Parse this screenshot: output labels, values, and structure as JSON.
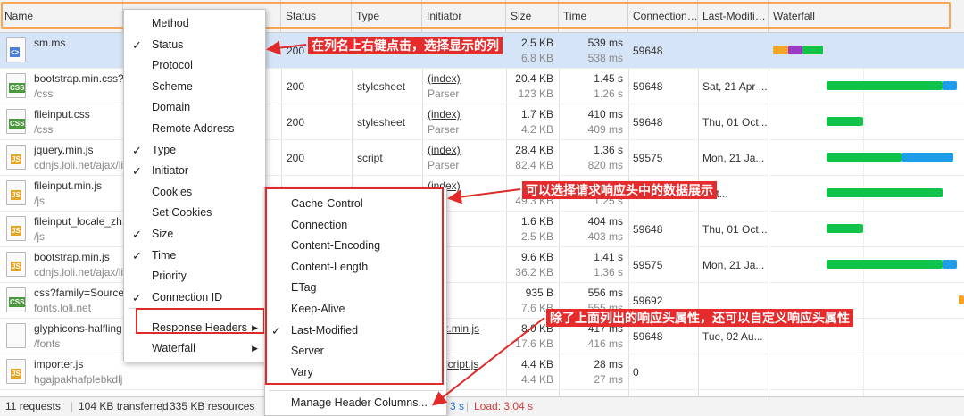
{
  "columns": [
    "Name",
    "Method",
    "Status",
    "Type",
    "Initiator",
    "Size",
    "Time",
    "Connection…",
    "Last-Modifi…",
    "Waterfall"
  ],
  "rows": [
    {
      "icon": "doc",
      "icon_text": "<>",
      "name": "sm.ms",
      "path": "",
      "status": "200",
      "type": "",
      "initiator": "",
      "initiator2": "",
      "size": "2.5 KB",
      "size2": "6.8 KB",
      "time": "539 ms",
      "time2": "538 ms",
      "conn": "59648",
      "lastmod": ""
    },
    {
      "icon": "css",
      "icon_text": "CSS",
      "name": "bootstrap.min.css?v",
      "path": "/css",
      "status": "200",
      "type": "stylesheet",
      "initiator": "(index)",
      "initiator2": "Parser",
      "size": "20.4 KB",
      "size2": "123 KB",
      "time": "1.45 s",
      "time2": "1.26 s",
      "conn": "59648",
      "lastmod": "Sat, 21 Apr ..."
    },
    {
      "icon": "css",
      "icon_text": "CSS",
      "name": "fileinput.css",
      "path": "/css",
      "status": "200",
      "type": "stylesheet",
      "initiator": "(index)",
      "initiator2": "Parser",
      "size": "1.7 KB",
      "size2": "4.2 KB",
      "time": "410 ms",
      "time2": "409 ms",
      "conn": "59648",
      "lastmod": "Thu, 01 Oct..."
    },
    {
      "icon": "js",
      "icon_text": "JS",
      "name": "jquery.min.js",
      "path": "cdnjs.loli.net/ajax/li",
      "status": "200",
      "type": "script",
      "initiator": "(index)",
      "initiator2": "Parser",
      "size": "28.4 KB",
      "size2": "82.4 KB",
      "time": "1.36 s",
      "time2": "820 ms",
      "conn": "59575",
      "lastmod": "Mon, 21 Ja..."
    },
    {
      "icon": "js",
      "icon_text": "JS",
      "name": "fileinput.min.js",
      "path": "/js",
      "status": "",
      "type": "",
      "initiator": "(index)",
      "initiator2": "",
      "size": "",
      "size2": "49.3 KB",
      "time": "",
      "time2": "1.25 s",
      "conn": "",
      "lastmod": "Oct..."
    },
    {
      "icon": "js",
      "icon_text": "JS",
      "name": "fileinput_locale_zh.j",
      "path": "/js",
      "status": "",
      "type": "",
      "initiator": "lex)",
      "initiator2": "er",
      "size": "1.6 KB",
      "size2": "2.5 KB",
      "time": "404 ms",
      "time2": "403 ms",
      "conn": "59648",
      "lastmod": "Thu, 01 Oct..."
    },
    {
      "icon": "js",
      "icon_text": "JS",
      "name": "bootstrap.min.js",
      "path": "cdnjs.loli.net/ajax/li",
      "status": "",
      "type": "",
      "initiator": "lex)",
      "initiator2": "er",
      "size": "9.6 KB",
      "size2": "36.2 KB",
      "time": "1.41 s",
      "time2": "1.36 s",
      "conn": "59575",
      "lastmod": "Mon, 21 Ja..."
    },
    {
      "icon": "css",
      "icon_text": "CSS",
      "name": "css?family=Source-",
      "path": "fonts.loli.net",
      "status": "",
      "type": "",
      "initiator": "",
      "initiator2": "",
      "size": "935 B",
      "size2": "7.6 KB",
      "time": "556 ms",
      "time2": "555 ms",
      "conn": "59692",
      "lastmod": ""
    },
    {
      "icon": "font",
      "icon_text": "",
      "name": "glyphicons-halfling",
      "path": "/fonts",
      "status": "",
      "type": "",
      "initiator": "nput.min.js",
      "initiator2": "t",
      "size": "8.0 KB",
      "size2": "17.6 KB",
      "time": "417 ms",
      "time2": "416 ms",
      "conn": "59648",
      "lastmod": "Tue, 02 Au..."
    },
    {
      "icon": "js",
      "icon_text": "JS",
      "name": "importer.js",
      "path": "hgajpakhafplebkdljleajgbpdmplhie/scripts",
      "status": "",
      "type": "",
      "initiator": "entscript.js",
      "initiator2": "t",
      "size": "4.4 KB",
      "size2": "4.4 KB",
      "time": "28 ms",
      "time2": "27 ms",
      "conn": "0",
      "lastmod": ""
    }
  ],
  "status_bar": {
    "requests": "11 requests",
    "transferred": "104 KB transferred",
    "resources": "335 KB resources",
    "finish": "3 s",
    "load": "Load: 3.04 s"
  },
  "menu": {
    "items": [
      {
        "label": "Method",
        "checked": false
      },
      {
        "label": "Status",
        "checked": true
      },
      {
        "label": "Protocol",
        "checked": false
      },
      {
        "label": "Scheme",
        "checked": false
      },
      {
        "label": "Domain",
        "checked": false
      },
      {
        "label": "Remote Address",
        "checked": false
      },
      {
        "label": "Type",
        "checked": true
      },
      {
        "label": "Initiator",
        "checked": true
      },
      {
        "label": "Cookies",
        "checked": false
      },
      {
        "label": "Set Cookies",
        "checked": false
      },
      {
        "label": "Size",
        "checked": true
      },
      {
        "label": "Time",
        "checked": true
      },
      {
        "label": "Priority",
        "checked": false
      },
      {
        "label": "Connection ID",
        "checked": true
      }
    ],
    "response_headers": "Response Headers",
    "waterfall": "Waterfall"
  },
  "submenu": {
    "items": [
      {
        "label": "Cache-Control",
        "checked": false
      },
      {
        "label": "Connection",
        "checked": false
      },
      {
        "label": "Content-Encoding",
        "checked": false
      },
      {
        "label": "Content-Length",
        "checked": false
      },
      {
        "label": "ETag",
        "checked": false
      },
      {
        "label": "Keep-Alive",
        "checked": false
      },
      {
        "label": "Last-Modified",
        "checked": true
      },
      {
        "label": "Server",
        "checked": false
      },
      {
        "label": "Vary",
        "checked": false
      }
    ],
    "manage": "Manage Header Columns..."
  },
  "annotations": {
    "a1": "在列名上右键点击，选择显示的列",
    "a2": "可以选择请求响应头中的数据展示",
    "a3": "除了上面列出的响应头属性，还可以自定义响应头属性"
  },
  "colors": {
    "accent_orange": "#f8a555",
    "red": "#e02a2a",
    "wf_green": "#0fc448",
    "wf_blue": "#1e9de8",
    "wf_orange": "#f8a526",
    "wf_purple": "#9b3ac6"
  }
}
